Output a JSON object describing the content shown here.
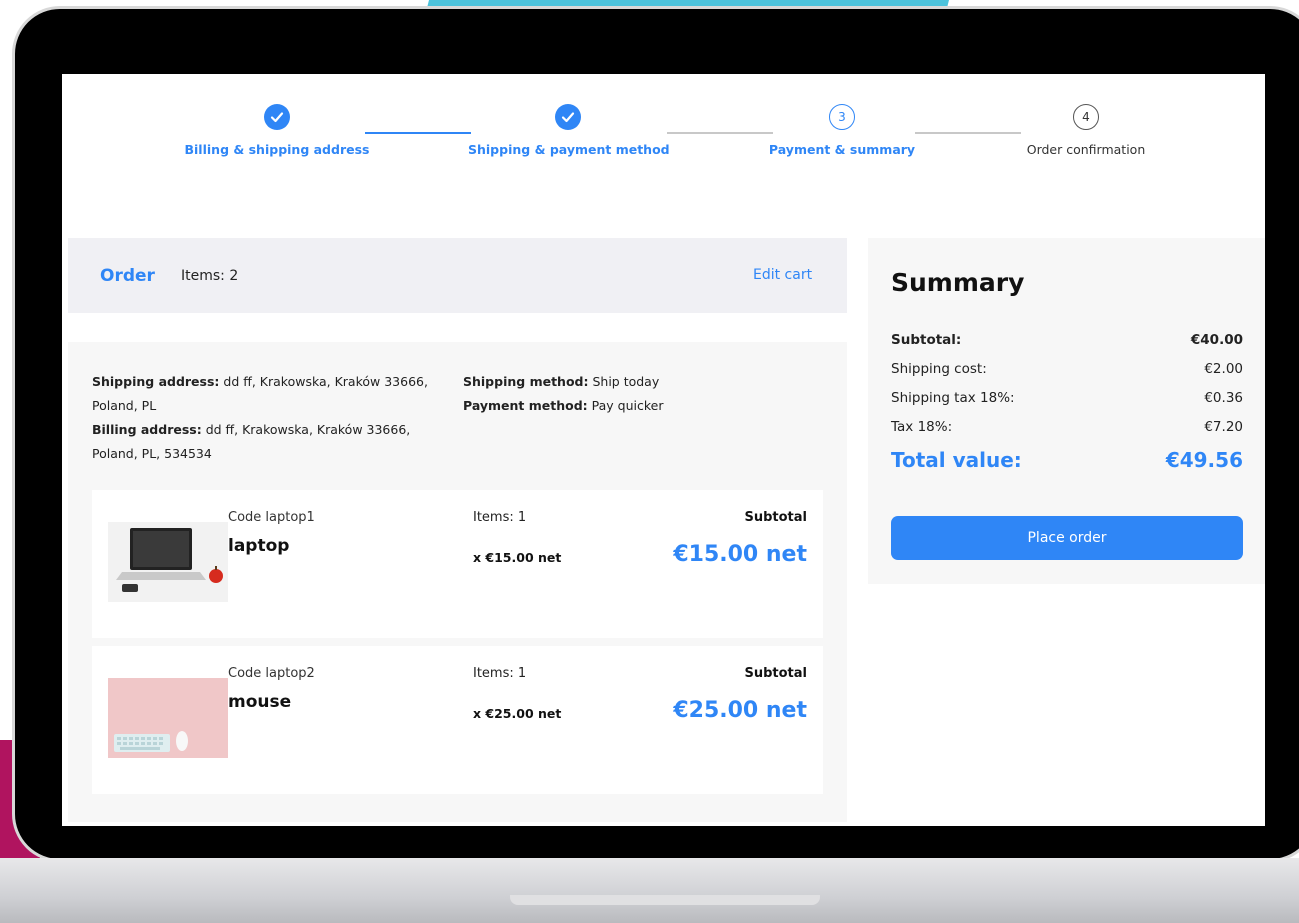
{
  "steps": [
    {
      "label": "Billing & shipping address",
      "state": "done"
    },
    {
      "label": "Shipping & payment method",
      "state": "done"
    },
    {
      "label": "Payment & summary",
      "state": "active",
      "number": "3"
    },
    {
      "label": "Order confirmation",
      "state": "pending",
      "number": "4"
    }
  ],
  "order": {
    "title": "Order",
    "items_count": "Items: 2",
    "edit_cart": "Edit cart"
  },
  "details": {
    "shipping_address_label": "Shipping address:",
    "shipping_address": " dd ff, Krakowska, Kraków 33666, Poland, PL",
    "billing_address_label": "Billing address:",
    "billing_address": " dd ff, Krakowska, Kraków 33666, Poland, PL, 534534",
    "shipping_method_label": "Shipping method:",
    "shipping_method": " Ship today",
    "payment_method_label": "Payment method:",
    "payment_method": " Pay quicker"
  },
  "items": [
    {
      "code": "Code laptop1",
      "name": "laptop",
      "qty": "Items: 1",
      "unit_price": "x €15.00 net",
      "subtotal_label": "Subtotal",
      "subtotal": "€15.00 net"
    },
    {
      "code": "Code laptop2",
      "name": "mouse",
      "qty": "Items: 1",
      "unit_price": "x €25.00 net",
      "subtotal_label": "Subtotal",
      "subtotal": "€25.00 net"
    }
  ],
  "summary": {
    "title": "Summary",
    "subtotal_label": "Subtotal:",
    "subtotal": "€40.00",
    "shipping_label": "Shipping cost:",
    "shipping": "€2.00",
    "shipping_tax_label": "Shipping tax 18%:",
    "shipping_tax": "€0.36",
    "tax_label": "Tax 18%:",
    "tax": "€7.20",
    "total_label": "Total value:",
    "total": "€49.56",
    "place_order": "Place order"
  },
  "colors": {
    "accent": "#2f86f6"
  }
}
